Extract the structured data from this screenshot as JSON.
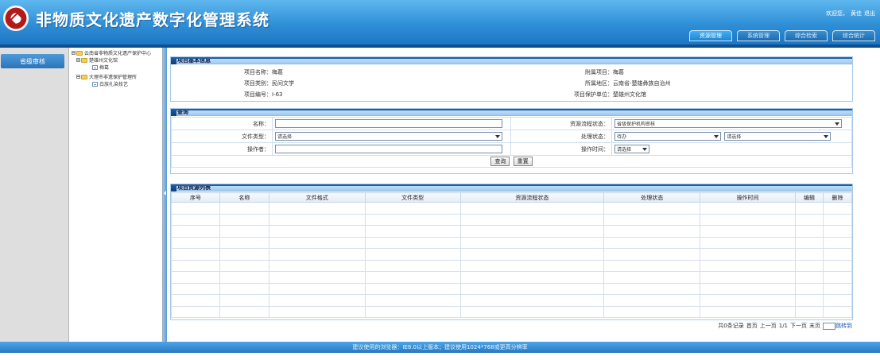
{
  "header": {
    "title": "非物质文化遗产数字化管理系统",
    "welcome": "欢迎您，",
    "username": "黄佳",
    "logout": "退出",
    "tabs": [
      {
        "label": "资源管理",
        "active": true
      },
      {
        "label": "系统管理",
        "active": false
      },
      {
        "label": "综合检索",
        "active": false
      },
      {
        "label": "综合统计",
        "active": false
      }
    ]
  },
  "left_nav": {
    "items": [
      {
        "label": "省级审核"
      }
    ]
  },
  "tree": {
    "nodes": [
      {
        "label": "云南省非物质文化遗产保护中心",
        "type": "folder",
        "level": 0
      },
      {
        "label": "楚雄州文化馆",
        "type": "folder",
        "level": 1
      },
      {
        "label": "梅葛",
        "type": "page",
        "level": 2
      },
      {
        "label": "大理市非遗保护管理所",
        "type": "folder",
        "level": 1
      },
      {
        "label": "白族扎染技艺",
        "type": "page",
        "level": 2
      }
    ]
  },
  "project_info": {
    "heading": "项目基本信息",
    "fields": [
      {
        "label": "项目名称：",
        "value": "梅葛"
      },
      {
        "label": "附属项目：",
        "value": "梅葛"
      },
      {
        "label": "项目类别：",
        "value": "民间文学"
      },
      {
        "label": "所属地区：",
        "value": "云南省-楚雄彝族自治州"
      },
      {
        "label": "项目编号：",
        "value": "I-63"
      },
      {
        "label": "项目保护单位：",
        "value": "楚雄州文化馆"
      }
    ]
  },
  "query": {
    "heading": "查询",
    "name_label": "名称：",
    "resource_status_label": "资源流程状态：",
    "resource_status_value": "省级保护机构审核",
    "file_type_label": "文件类型：",
    "file_type_value": "请选择",
    "process_status_label": "处理状态：",
    "process_status_value": "待办",
    "process_status_value2": "请选择",
    "operator_label": "操作者：",
    "operate_time_label": "操作时间：",
    "operate_time_value": "请选择",
    "search_button": "查询",
    "reset_button": "重置"
  },
  "resource_list": {
    "heading": "项目资源列表",
    "columns": [
      "序号",
      "名称",
      "文件格式",
      "文件类型",
      "资源流程状态",
      "处理状态",
      "操作时间",
      "编辑",
      "删除"
    ],
    "rows": []
  },
  "pager": {
    "records": "共0条记录",
    "first": "首页",
    "prev": "上一页",
    "page": "1/1",
    "next": "下一页",
    "last": "末页",
    "jump": "跳转到"
  },
  "footer": {
    "text": "建议使用的浏览器：IE8.0以上版本；建议使用1024*768或更高分辨率"
  }
}
